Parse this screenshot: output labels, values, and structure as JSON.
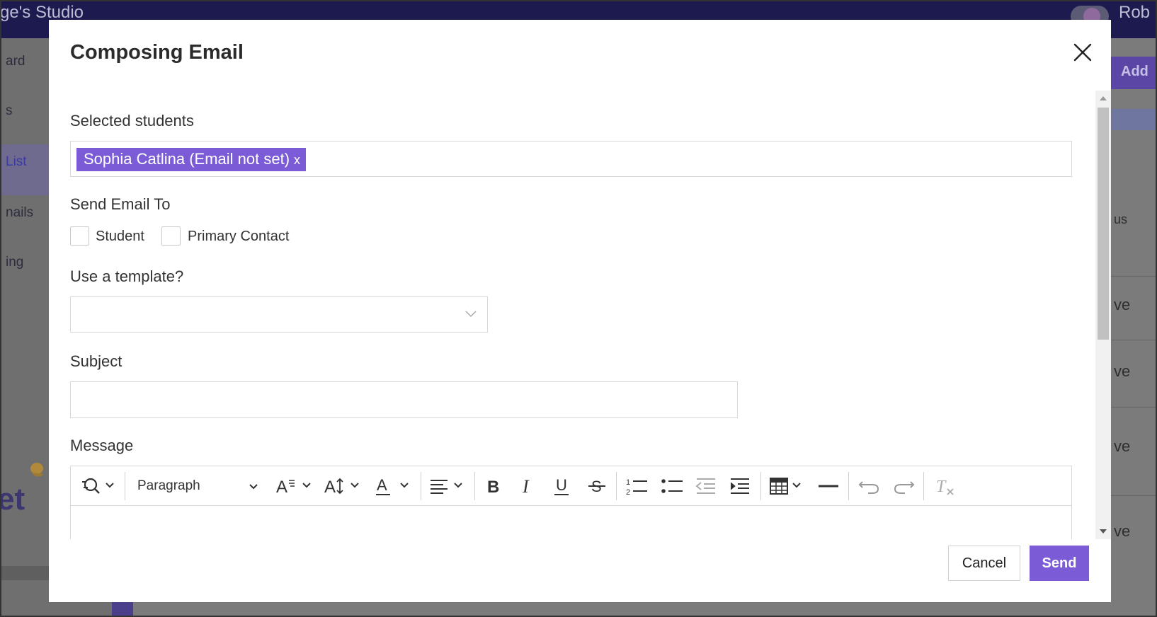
{
  "background": {
    "studio_title": "ge's Studio",
    "user_name": "Rob",
    "sidebar_items": [
      "ard",
      "s",
      "List",
      "nails",
      "ing"
    ],
    "add_button": "Add",
    "table_fragments": [
      "us",
      "ve",
      "ve",
      "ve",
      "ve"
    ]
  },
  "modal": {
    "title": "Composing Email",
    "selected_students_label": "Selected students",
    "tags": [
      {
        "label": "Sophia Catlina (Email not set)",
        "remove": "x"
      }
    ],
    "send_to_label": "Send Email To",
    "recipients": [
      {
        "label": "Student",
        "checked": false
      },
      {
        "label": "Primary Contact",
        "checked": false
      }
    ],
    "template_label": "Use a template?",
    "template_value": "",
    "subject_label": "Subject",
    "subject_value": "",
    "message_label": "Message",
    "editor": {
      "block_format": "Paragraph",
      "tools": [
        "find-replace",
        "block-format",
        "font-style",
        "font-size",
        "font-color",
        "align",
        "bold",
        "italic",
        "underline",
        "strikethrough",
        "numbered-list",
        "bullet-list",
        "outdent",
        "indent",
        "table",
        "horizontal-rule",
        "undo",
        "redo",
        "clear-formatting"
      ]
    },
    "cancel_label": "Cancel",
    "send_label": "Send"
  },
  "colors": {
    "accent": "#7b5cd6",
    "topbar": "#1c1a4f"
  }
}
